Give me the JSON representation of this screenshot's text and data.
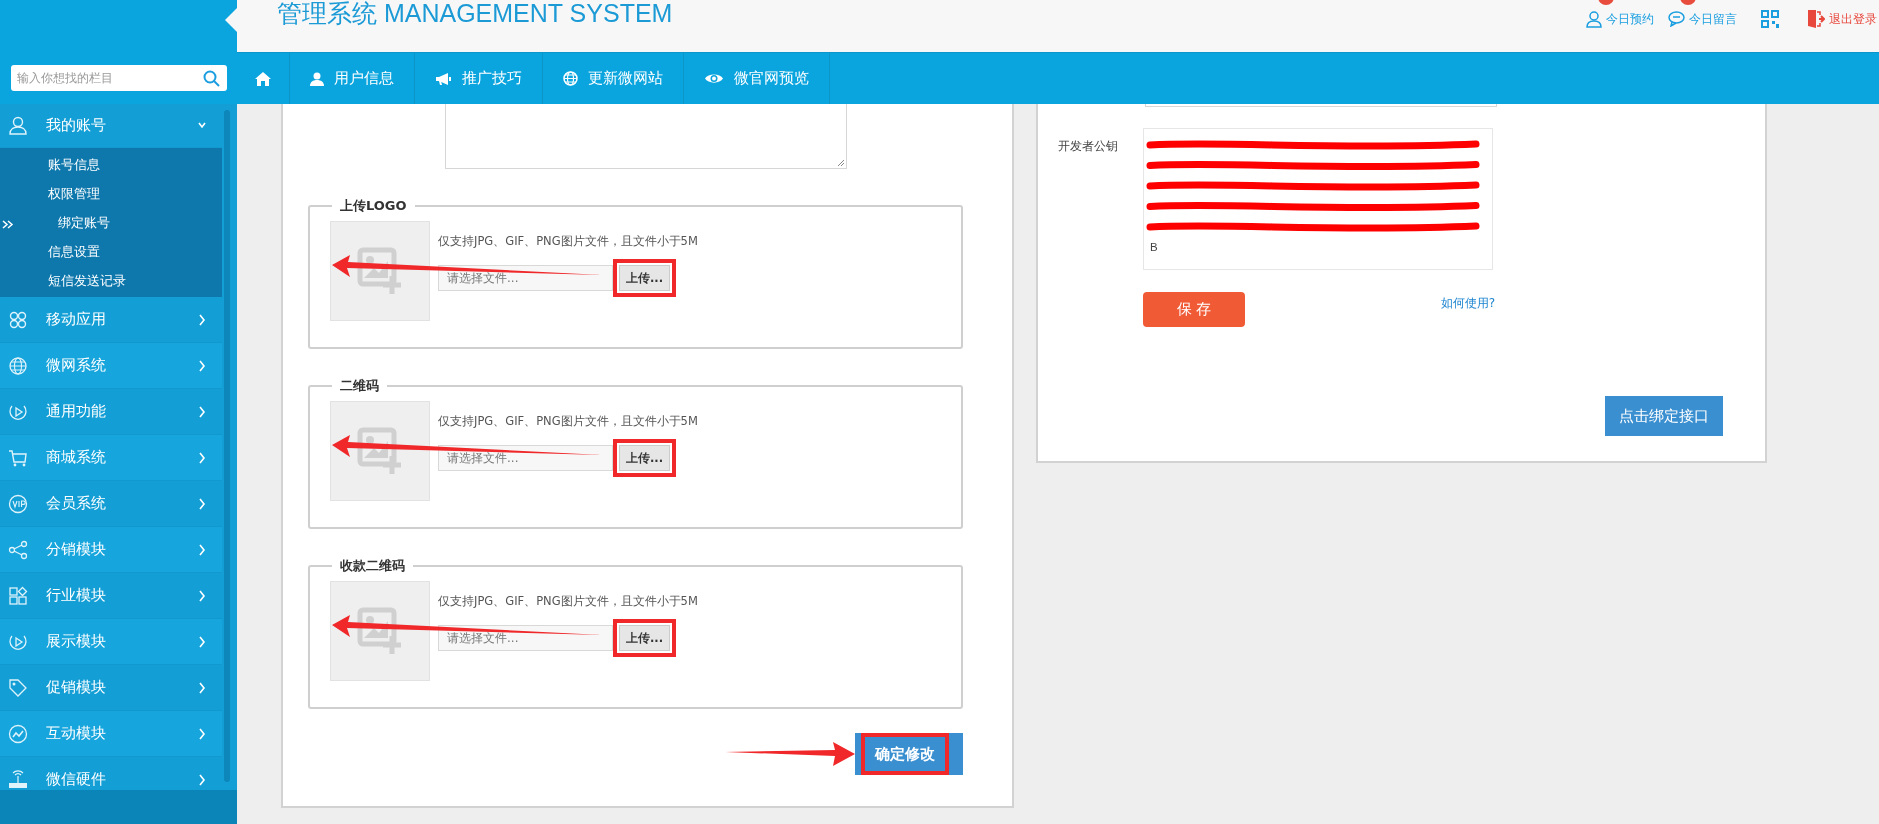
{
  "header": {
    "title": "管理系统 MANAGEMENT SYSTEM",
    "top_links": [
      {
        "kind": "appointment",
        "label": "今日预约",
        "badge": true
      },
      {
        "kind": "message",
        "label": "今日留言",
        "badge": true
      },
      {
        "kind": "qrcode"
      },
      {
        "kind": "logout",
        "label": "退出登录"
      }
    ]
  },
  "search": {
    "placeholder": "输入你想找的栏目"
  },
  "nav": [
    {
      "kind": "home"
    },
    {
      "kind": "user",
      "label": "用户信息"
    },
    {
      "kind": "megaphone",
      "label": "推广技巧"
    },
    {
      "kind": "globe",
      "label": "更新微网站"
    },
    {
      "kind": "eye",
      "label": "微官网预览"
    }
  ],
  "sidebar": {
    "items": [
      {
        "label": "我的账号",
        "expanded": true,
        "children": [
          {
            "label": "账号信息",
            "selected": false
          },
          {
            "label": "权限管理",
            "selected": false
          },
          {
            "label": "绑定账号",
            "selected": true
          },
          {
            "label": "信息设置",
            "selected": false
          },
          {
            "label": "短信发送记录",
            "selected": false
          }
        ]
      },
      {
        "label": "移动应用",
        "expanded": false
      },
      {
        "label": "微网系统",
        "expanded": false
      },
      {
        "label": "通用功能",
        "expanded": false
      },
      {
        "label": "商城系统",
        "expanded": false
      },
      {
        "label": "会员系统",
        "expanded": false
      },
      {
        "label": "分销模块",
        "expanded": false
      },
      {
        "label": "行业模块",
        "expanded": false
      },
      {
        "label": "展示模块",
        "expanded": false
      },
      {
        "label": "促销模块",
        "expanded": false
      },
      {
        "label": "互动模块",
        "expanded": false
      },
      {
        "label": "微信硬件",
        "expanded": false
      }
    ]
  },
  "left_panel": {
    "uploads": [
      {
        "legend": "上传LOGO",
        "hint": "仅支持JPG、GIF、PNG图片文件，且文件小于5M",
        "placeholder": "请选择文件...",
        "button": "上传...",
        "highlighted": true,
        "arrow": true
      },
      {
        "legend": "二维码",
        "hint": "仅支持JPG、GIF、PNG图片文件，且文件小于5M",
        "placeholder": "请选择文件...",
        "button": "上传...",
        "highlighted": true,
        "arrow": true
      },
      {
        "legend": "收款二维码",
        "hint": "仅支持JPG、GIF、PNG图片文件，且文件小于5M",
        "placeholder": "请选择文件...",
        "button": "上传...",
        "highlighted": true,
        "arrow": true
      }
    ],
    "submit": {
      "label": "确定修改",
      "highlighted": true,
      "arrow": true
    }
  },
  "right_panel": {
    "public_key": {
      "label": "开发者公钥",
      "redacted": true,
      "value_lines": [
        "B"
      ]
    },
    "save": "保 存",
    "help_link": "如何使用?",
    "bind": "点击绑定接口"
  }
}
